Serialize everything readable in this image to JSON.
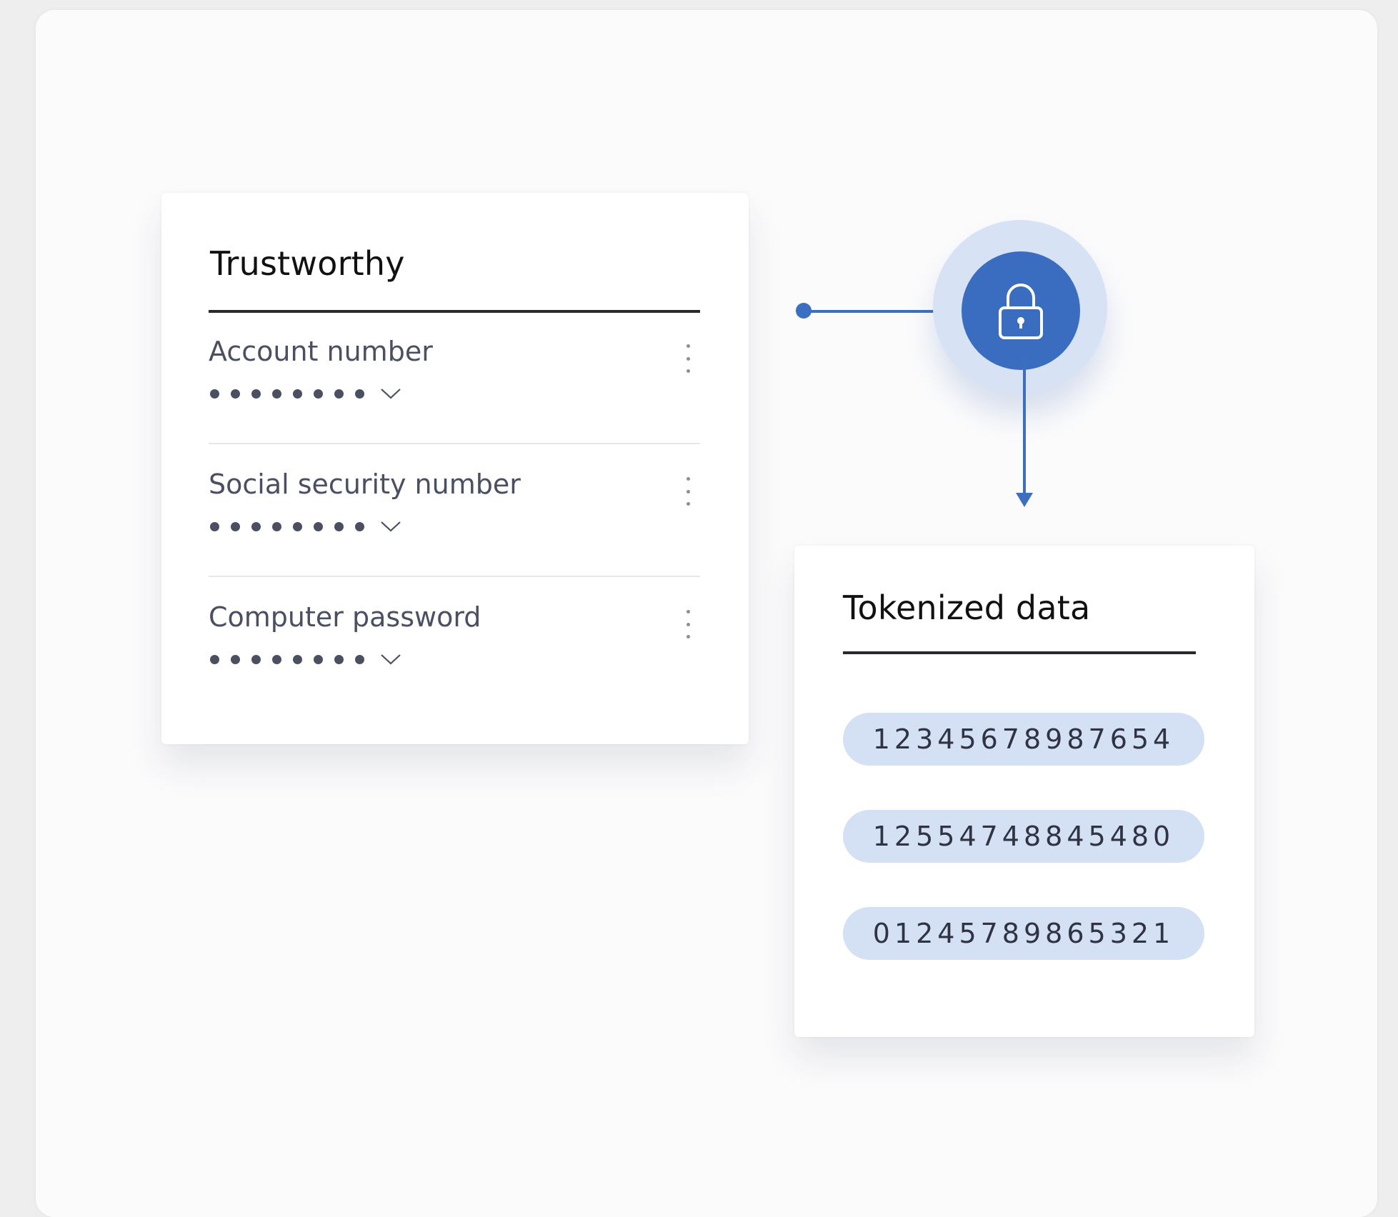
{
  "left_card": {
    "title": "Trustworthy",
    "fields": [
      {
        "label": "Account number",
        "masked_dots": 8,
        "menu_icon": "kebab-menu-icon",
        "toggle_icon": "chevron-down-icon"
      },
      {
        "label": "Social security number",
        "masked_dots": 8,
        "menu_icon": "kebab-menu-icon",
        "toggle_icon": "chevron-down-icon"
      },
      {
        "label": "Computer password",
        "masked_dots": 8,
        "menu_icon": "kebab-menu-icon",
        "toggle_icon": "chevron-down-icon"
      }
    ]
  },
  "connector": {
    "icon": "lock-icon",
    "color": "#3d6fc0",
    "halo_color": "#d7e3f5"
  },
  "right_card": {
    "title": "Tokenized data",
    "tokens": [
      "12345678987654",
      "12554748845480",
      "01245789865321"
    ],
    "token_bg": "#d4e1f5"
  }
}
